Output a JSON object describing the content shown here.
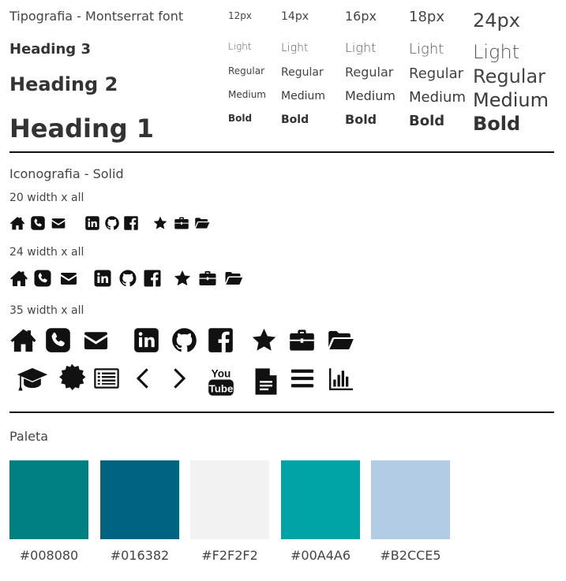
{
  "typography": {
    "title": "Tipografia - Montserrat font",
    "heading3": "Heading 3",
    "heading2": "Heading 2",
    "heading1": "Heading 1",
    "sizes": [
      "12px",
      "14px",
      "16px",
      "18px",
      "24px"
    ],
    "weights": [
      "Light",
      "Regular",
      "Medium",
      "Bold"
    ]
  },
  "icons": {
    "title": "Iconografia - Solid",
    "size_labels": [
      "20 width x all",
      "24 width x all",
      "35 width x all"
    ],
    "row_icons": [
      "home-icon",
      "phone-icon",
      "envelope-icon",
      "linkedin-icon",
      "github-icon",
      "facebook-icon",
      "star-icon",
      "briefcase-icon",
      "folder-open-icon"
    ],
    "extra_icons": [
      "graduation-cap-icon",
      "certificate-icon",
      "list-alt-icon",
      "chevron-left-icon",
      "chevron-right-icon",
      "youtube-icon",
      "file-text-icon",
      "bars-icon",
      "bar-chart-icon"
    ]
  },
  "palette": {
    "title": "Paleta",
    "colors": [
      {
        "hex": "#008080",
        "label": "#008080"
      },
      {
        "hex": "#016382",
        "label": "#016382"
      },
      {
        "hex": "#F2F2F2",
        "label": "#F2F2F2"
      },
      {
        "hex": "#00A4A6",
        "label": "#00A4A6"
      },
      {
        "hex": "#B2CCE5",
        "label": "#B2CCE5"
      }
    ]
  }
}
